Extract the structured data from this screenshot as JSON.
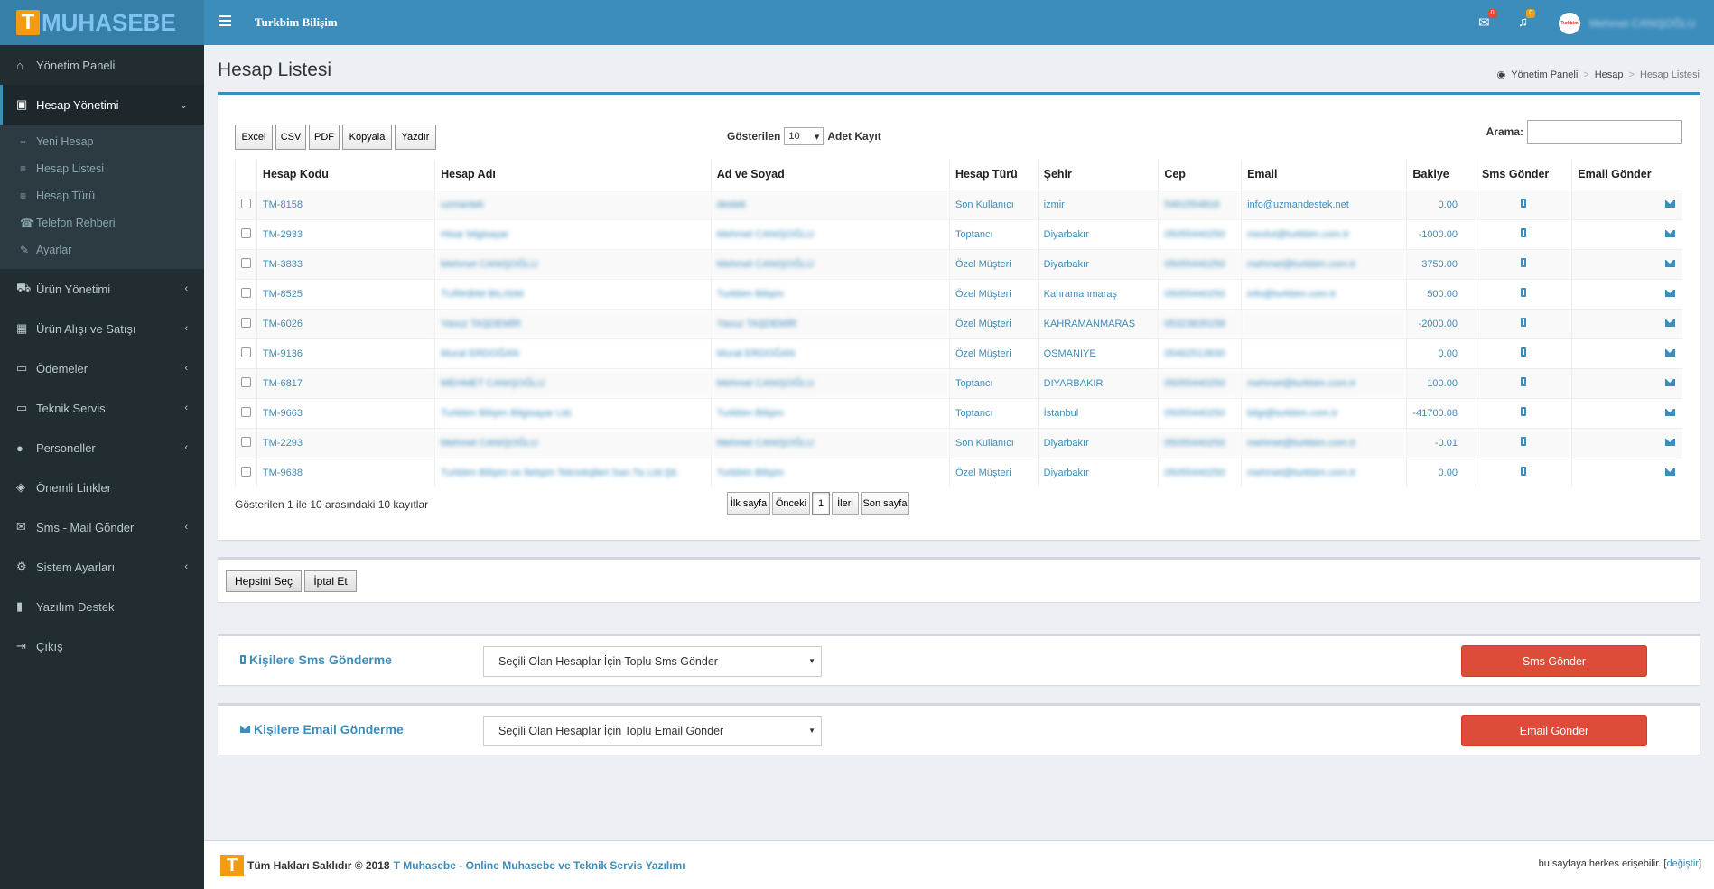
{
  "brand": {
    "logo_letter": "T",
    "logo_text": "MUHASEBE",
    "company": "Turkbim Bilişim",
    "avatar_text": "Turkbim",
    "username": "Mehmet CANIŞOĞLU"
  },
  "notifications": {
    "mail_count": "0",
    "bell_count": "0"
  },
  "sidebar": {
    "items": [
      {
        "label": "Yönetim Paneli",
        "icon": "home-icon",
        "glyph": "⌂"
      },
      {
        "label": "Hesap Yönetimi",
        "icon": "id-card-icon",
        "glyph": "▣",
        "expanded": true
      },
      {
        "label": "Ürün Yönetimi",
        "icon": "cart-icon",
        "glyph": "⛟"
      },
      {
        "label": "Ürün Alışı ve Satışı",
        "icon": "grid-icon",
        "glyph": "▦"
      },
      {
        "label": "Ödemeler",
        "icon": "credit-card-icon",
        "glyph": "▭"
      },
      {
        "label": "Teknik Servis",
        "icon": "laptop-icon",
        "glyph": "▭"
      },
      {
        "label": "Personeller",
        "icon": "user-icon",
        "glyph": "●"
      },
      {
        "label": "Önemli Linkler",
        "icon": "tags-icon",
        "glyph": "◈"
      },
      {
        "label": "Sms - Mail Gönder",
        "icon": "envelope-icon",
        "glyph": "✉"
      },
      {
        "label": "Sistem Ayarları",
        "icon": "gear-icon",
        "glyph": "⚙"
      },
      {
        "label": "Yazılım Destek",
        "icon": "bookmark-icon",
        "glyph": "▮"
      },
      {
        "label": "Çıkış",
        "icon": "sign-out-icon",
        "glyph": "⇥"
      }
    ],
    "subitems": [
      {
        "label": "Yeni Hesap",
        "icon": "plus-icon",
        "glyph": "+"
      },
      {
        "label": "Hesap Listesi",
        "icon": "list-icon",
        "glyph": "≡"
      },
      {
        "label": "Hesap Türü",
        "icon": "list-icon",
        "glyph": "≡"
      },
      {
        "label": "Telefon Rehberi",
        "icon": "phone-icon",
        "glyph": "☎"
      },
      {
        "label": "Ayarlar",
        "icon": "wrench-icon",
        "glyph": "✎"
      }
    ]
  },
  "page": {
    "title": "Hesap Listesi"
  },
  "breadcrumb": {
    "home": "Yönetim Paneli",
    "section": "Hesap",
    "current": "Hesap Listesi"
  },
  "toolbar": {
    "excel": "Excel",
    "csv": "CSV",
    "pdf": "PDF",
    "copy": "Kopyala",
    "print": "Yazdır"
  },
  "length": {
    "prefix": "Gösterilen",
    "value": "10",
    "suffix": "Adet Kayıt"
  },
  "search": {
    "label": "Arama:",
    "value": ""
  },
  "table": {
    "headers": [
      "Hesap Kodu",
      "Hesap Adı",
      "Ad ve Soyad",
      "Hesap Türü",
      "Şehir",
      "Cep",
      "Email",
      "Bakiye",
      "Sms Gönder",
      "Email Gönder"
    ],
    "rows": [
      {
        "code": "TM-8158",
        "name": "uzmantek",
        "person": "destek",
        "type": "Son Kullanıcı",
        "city": "izmir",
        "phone": "5461554816",
        "email": "info@uzmandestek.net",
        "balance": "0.00"
      },
      {
        "code": "TM-2933",
        "name": "Hisar bilgisayar",
        "person": "Mehmet CANIŞOĞLU",
        "type": "Toptancı",
        "city": "Diyarbakır",
        "phone": "05055440250",
        "email": "mevlut@turkbim.com.tr",
        "balance": "-1000.00"
      },
      {
        "code": "TM-3833",
        "name": "Mehmet CANIŞOĞLU",
        "person": "Mehmet CANIŞOĞLU",
        "type": "Özel Müşteri",
        "city": "Diyarbakır",
        "phone": "05055440250",
        "email": "mehmet@turkbim.com.tr",
        "balance": "3750.00"
      },
      {
        "code": "TM-8525",
        "name": "TURKBIM BILISIM",
        "person": "Turkbim Bilişim",
        "type": "Özel Müşteri",
        "city": "Kahramanmaraş",
        "phone": "05055440250",
        "email": "info@turkbim.com.tr",
        "balance": "500.00"
      },
      {
        "code": "TM-6026",
        "name": "Yavuz TAŞDEMİR",
        "person": "Yavuz TAŞDEMİR",
        "type": "Özel Müşteri",
        "city": "KAHRAMANMARAS",
        "phone": "05323835158",
        "email": "",
        "balance": "-2000.00"
      },
      {
        "code": "TM-9136",
        "name": "Murat ERDOĞAN",
        "person": "Murat ERDOĞAN",
        "type": "Özel Müşteri",
        "city": "OSMANIYE",
        "phone": "05462513830",
        "email": "",
        "balance": "0.00"
      },
      {
        "code": "TM-6817",
        "name": "MEHMET CANIŞOĞLU",
        "person": "Mehmet CANIŞOĞLU",
        "type": "Toptancı",
        "city": "DIYARBAKIR",
        "phone": "05055440250",
        "email": "mehmet@turkbim.com.tr",
        "balance": "100.00"
      },
      {
        "code": "TM-9663",
        "name": "Turkbim Bilişim Bilgisayar Ltd.",
        "person": "Turkbim Bilişim",
        "type": "Toptancı",
        "city": "İstanbul",
        "phone": "05055440250",
        "email": "bilgi@turkbim.com.tr",
        "balance": "-41700.08"
      },
      {
        "code": "TM-2293",
        "name": "Mehmet CANIŞOĞLU",
        "person": "Mehmet CANIŞOĞLU",
        "type": "Son Kullanıcı",
        "city": "Diyarbakır",
        "phone": "05055440250",
        "email": "mehmet@turkbim.com.tr",
        "balance": "-0.01"
      },
      {
        "code": "TM-9638",
        "name": "Turkbim Bilişim ve İletişim Teknolojileri San.Tic.Ltd.Şti.",
        "person": "Turkbim Bilişim",
        "type": "Özel Müşteri",
        "city": "Diyarbakır",
        "phone": "05055440250",
        "email": "mehmet@turkbim.com.tr",
        "balance": "0.00"
      }
    ]
  },
  "info": "Gösterilen 1 ile 10 arasındaki 10 kayıtlar",
  "pagination": {
    "first": "İlk sayfa",
    "prev": "Önceki",
    "page": "1",
    "next": "İleri",
    "last": "Son sayfa"
  },
  "bulk": {
    "select_all": "Hepsini Seç",
    "cancel": "İptal Et"
  },
  "sms_section": {
    "title": "Kişilere Sms Gönderme",
    "select": "Seçili Olan Hesaplar İçin Toplu Sms Gönder",
    "button": "Sms Gönder"
  },
  "email_section": {
    "title": "Kişilere Email Gönderme",
    "select": "Seçili Olan Hesaplar İçin Toplu Email Gönder",
    "button": "Email Gönder"
  },
  "footer": {
    "prefix": "Tüm Hakları Saklıdır © 2018",
    "link": "T Muhasebe - Online Muhasebe ve Teknik Servis Yazılımı",
    "right_text": "bu sayfaya herkes erişebilir.",
    "right_link": "değiştir"
  },
  "colors": {
    "primary": "#3c8dbc",
    "sidebar": "#222d32",
    "danger": "#dd4b39",
    "logo": "#f39c12"
  }
}
